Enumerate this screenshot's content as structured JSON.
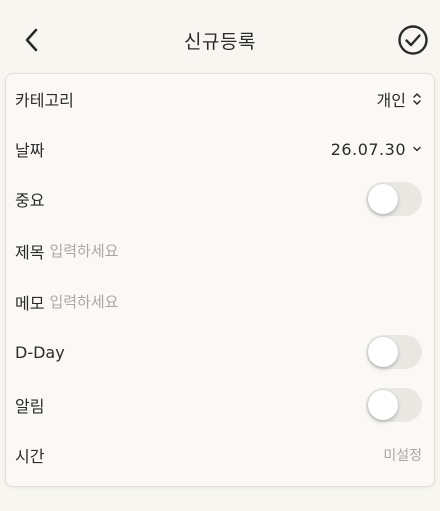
{
  "header": {
    "title": "신규등록",
    "back_icon": "chevron-left-icon",
    "confirm_icon": "check-circle-icon"
  },
  "form": {
    "category": {
      "label": "카테고리",
      "value": "개인"
    },
    "date": {
      "label": "날짜",
      "value": "26.07.30"
    },
    "important": {
      "label": "중요",
      "on": false
    },
    "title": {
      "label": "제목",
      "placeholder": "입력하세요"
    },
    "memo": {
      "label": "메모",
      "placeholder": "입력하세요"
    },
    "dday": {
      "label": "D-Day",
      "on": false
    },
    "alarm": {
      "label": "알림",
      "on": false
    },
    "time": {
      "label": "시간",
      "value": "미설정"
    }
  },
  "colors": {
    "background": "#f7f6f1",
    "card": "#faf9f5",
    "toggle_off": "#e9e8e3",
    "muted_text": "#a9a8a3"
  }
}
